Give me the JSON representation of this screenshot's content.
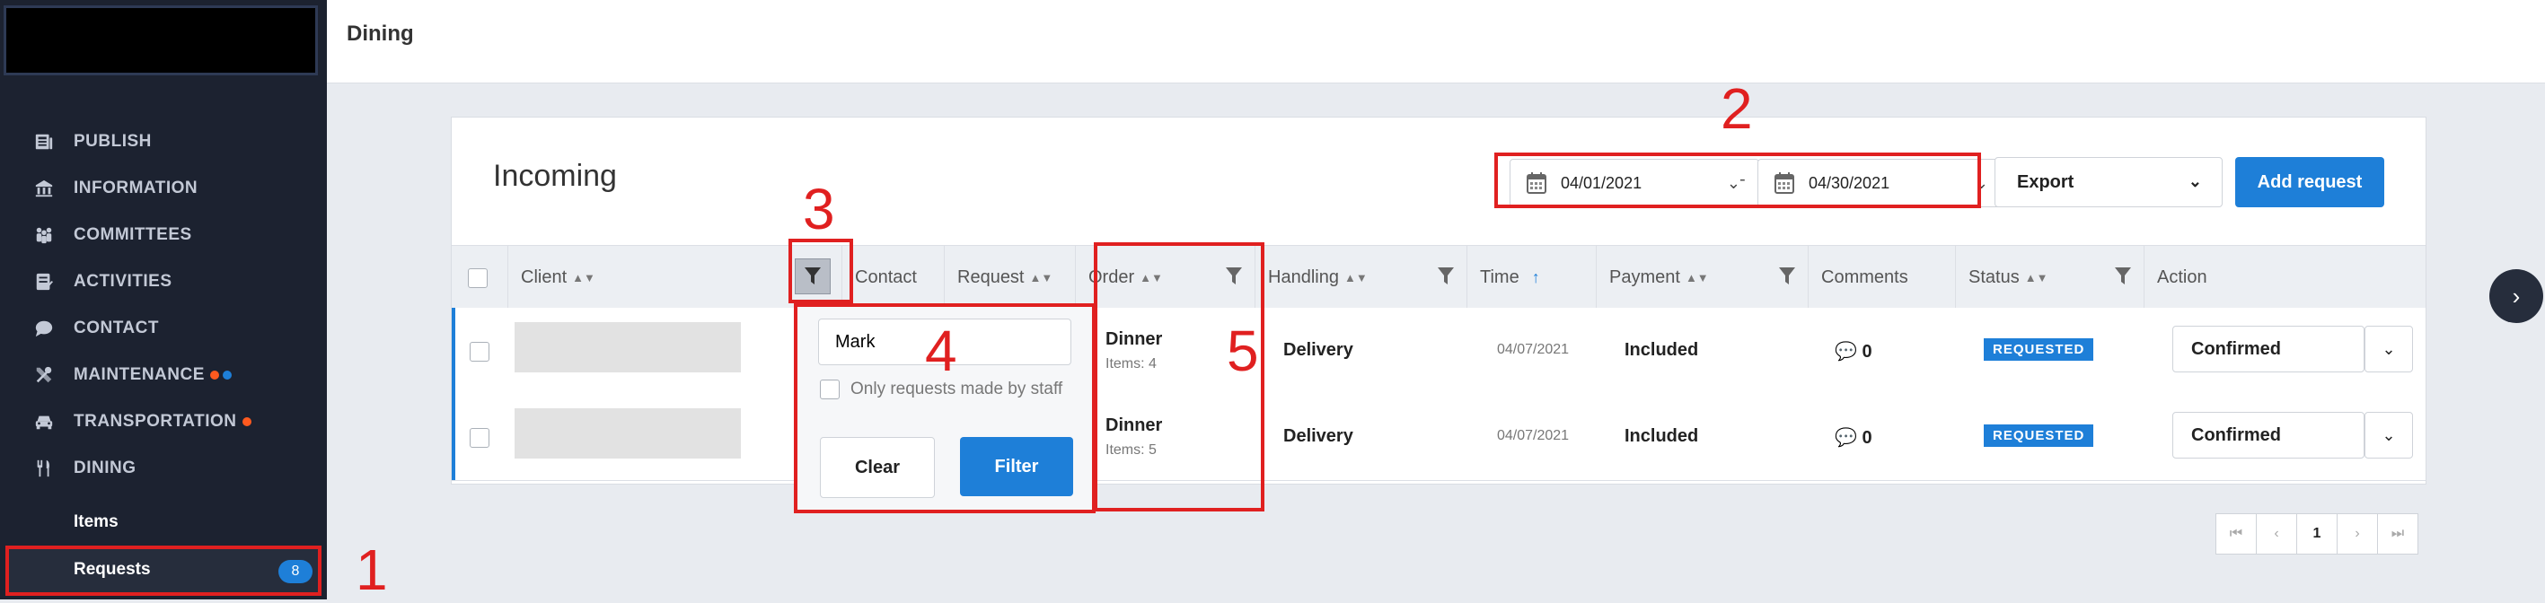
{
  "sidebar": {
    "nav": [
      {
        "label": "PUBLISH",
        "icon": "newspaper-icon"
      },
      {
        "label": "INFORMATION",
        "icon": "building-icon"
      },
      {
        "label": "COMMITTEES",
        "icon": "people-icon"
      },
      {
        "label": "ACTIVITIES",
        "icon": "checklist-icon"
      },
      {
        "label": "CONTACT",
        "icon": "chat-bubble-icon"
      },
      {
        "label": "MAINTENANCE",
        "icon": "tools-icon"
      },
      {
        "label": "TRANSPORTATION",
        "icon": "car-icon"
      },
      {
        "label": "DINING",
        "icon": "utensils-icon"
      }
    ],
    "sub_items": [
      "Items",
      "Requests"
    ],
    "requests_badge": "8",
    "dot_colors": {
      "orange": "#ff5a1f",
      "blue": "#1e7fd8"
    }
  },
  "header": {
    "title": "Dining"
  },
  "card": {
    "title": "Incoming",
    "date_from": "04/01/2021",
    "date_separator": "-",
    "date_to": "04/30/2021",
    "export_label": "Export",
    "add_label": "Add request"
  },
  "table": {
    "columns": [
      "Client",
      "Contact",
      "Request",
      "Order",
      "Handling",
      "Time",
      "Payment",
      "Comments",
      "Status",
      "Action"
    ],
    "rows": [
      {
        "order": "Dinner",
        "items": "Items: 4",
        "handling": "Delivery",
        "time": "04/07/2021",
        "payment": "Included",
        "comments": "0",
        "status": "REQUESTED",
        "action": "Confirmed"
      },
      {
        "order": "Dinner",
        "items": "Items: 5",
        "handling": "Delivery",
        "time": "04/07/2021",
        "payment": "Included",
        "comments": "0",
        "status": "REQUESTED",
        "action": "Confirmed"
      }
    ]
  },
  "filter_popup": {
    "value": "Mark",
    "checkbox_label": "Only requests made by staff",
    "clear_label": "Clear",
    "filter_label": "Filter"
  },
  "pagination": {
    "current": "1"
  },
  "annotations": [
    "1",
    "2",
    "3",
    "4",
    "5"
  ],
  "colors": {
    "accent": "#1e7fd8",
    "sidebar": "#1c2230",
    "annotation": "#e02020"
  }
}
